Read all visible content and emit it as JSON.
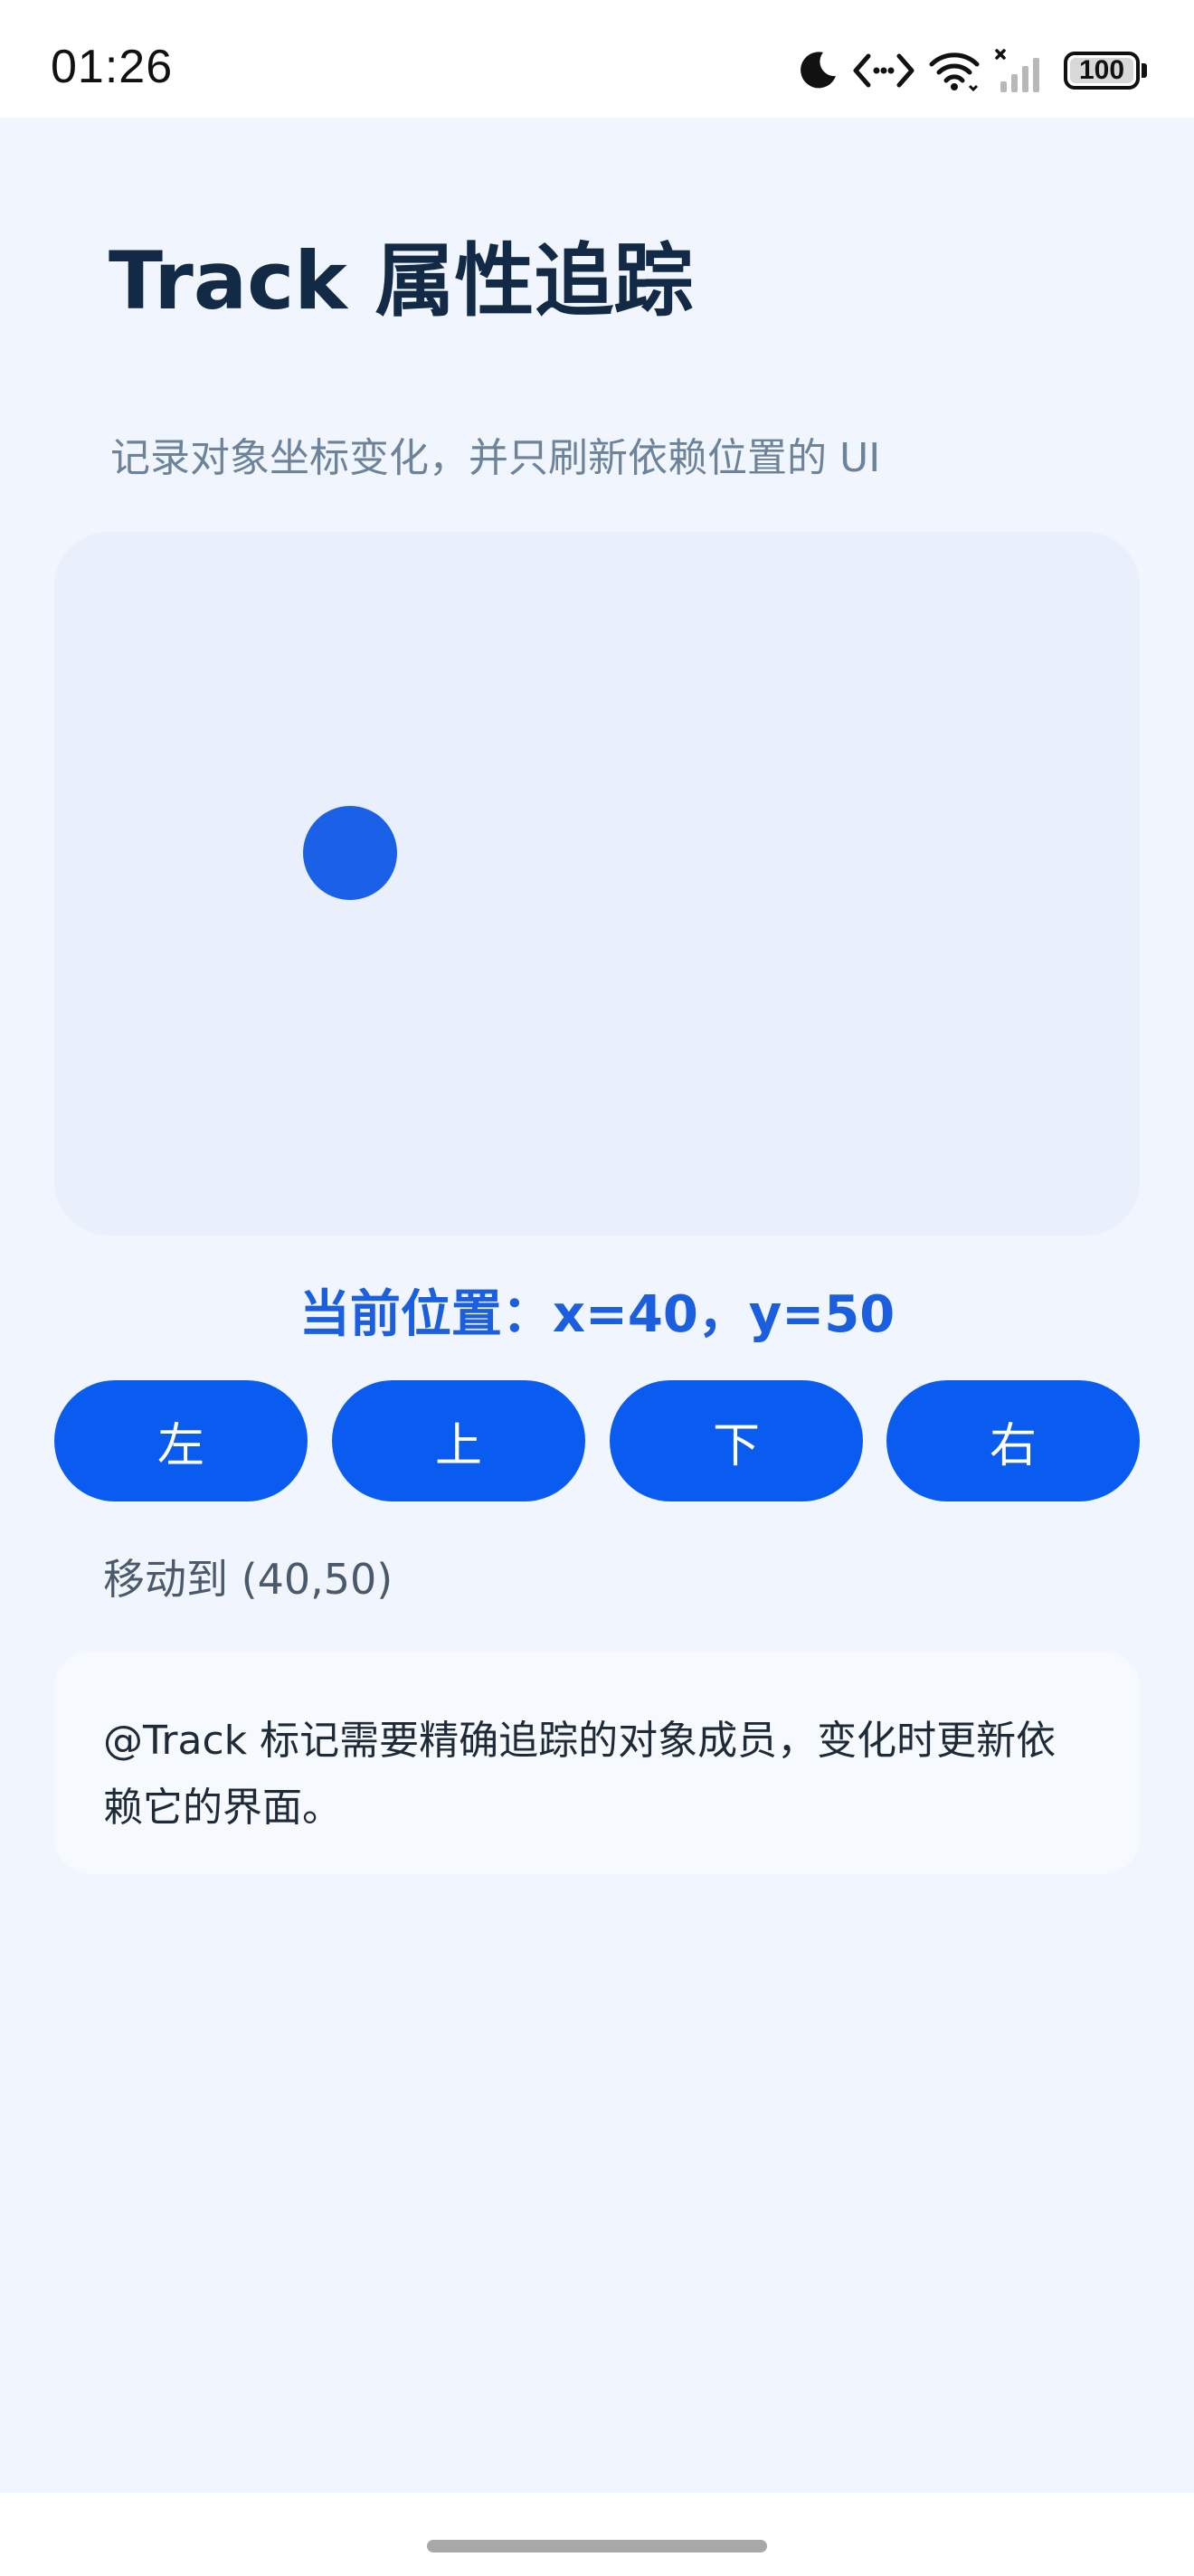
{
  "status_bar": {
    "time": "01:26",
    "battery": "100"
  },
  "page": {
    "title": "Track 属性追踪",
    "subtitle": "记录对象坐标变化，并只刷新依赖位置的 UI"
  },
  "tracker": {
    "x": 40,
    "y": 50,
    "position_label": "当前位置：x=40，y=50",
    "move_status": "移动到 (40,50)"
  },
  "controls": {
    "left_label": "左",
    "up_label": "上",
    "down_label": "下",
    "right_label": "右"
  },
  "note": {
    "text": "@Track 标记需要精确追踪的对象成员，变化时更新依赖它的界面。"
  },
  "colors": {
    "accent": "#0a5cf0",
    "ball": "#1a61e8",
    "title": "#122a45",
    "background": "#f1f6fe",
    "canvas": "#e9f0fb"
  }
}
